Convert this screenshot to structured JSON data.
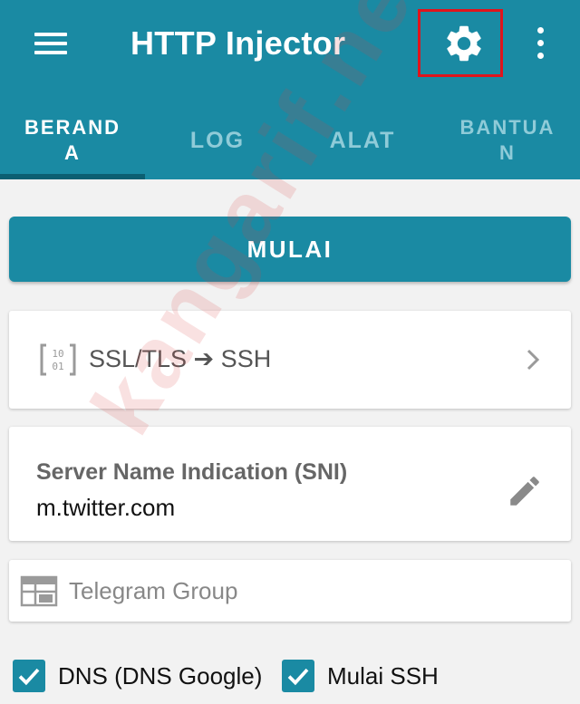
{
  "app_bar": {
    "title": "HTTP Injector",
    "background": "#1a8aa3",
    "menu_icon": "hamburger-menu-icon",
    "settings_icon": "gear-icon",
    "overflow_icon": "more-vert-icon",
    "highlight_color": "#e0141c"
  },
  "tabs": [
    {
      "line1": "BERAND",
      "line2": "A",
      "active": true
    },
    {
      "label": "LOG",
      "active": false
    },
    {
      "label": "ALAT",
      "active": false
    },
    {
      "line1": "BANTUA",
      "line2": "N",
      "active": false
    }
  ],
  "start_button": {
    "label": "MULAI"
  },
  "mode_card": {
    "label": "SSL/TLS ➔ SSH",
    "icon": "binary-brackets-icon",
    "chevron_icon": "chevron-right-icon"
  },
  "sni_card": {
    "title": "Server Name Indication (SNI)",
    "value": "m.twitter.com",
    "edit_icon": "pencil-icon"
  },
  "group_field": {
    "placeholder": "Telegram Group",
    "value": "",
    "icon": "calendar-table-icon"
  },
  "checks": [
    {
      "label": "DNS (DNS Google)",
      "checked": true
    },
    {
      "label": "Mulai SSH",
      "checked": true
    }
  ],
  "watermark": {
    "text": "kangarif.net"
  }
}
